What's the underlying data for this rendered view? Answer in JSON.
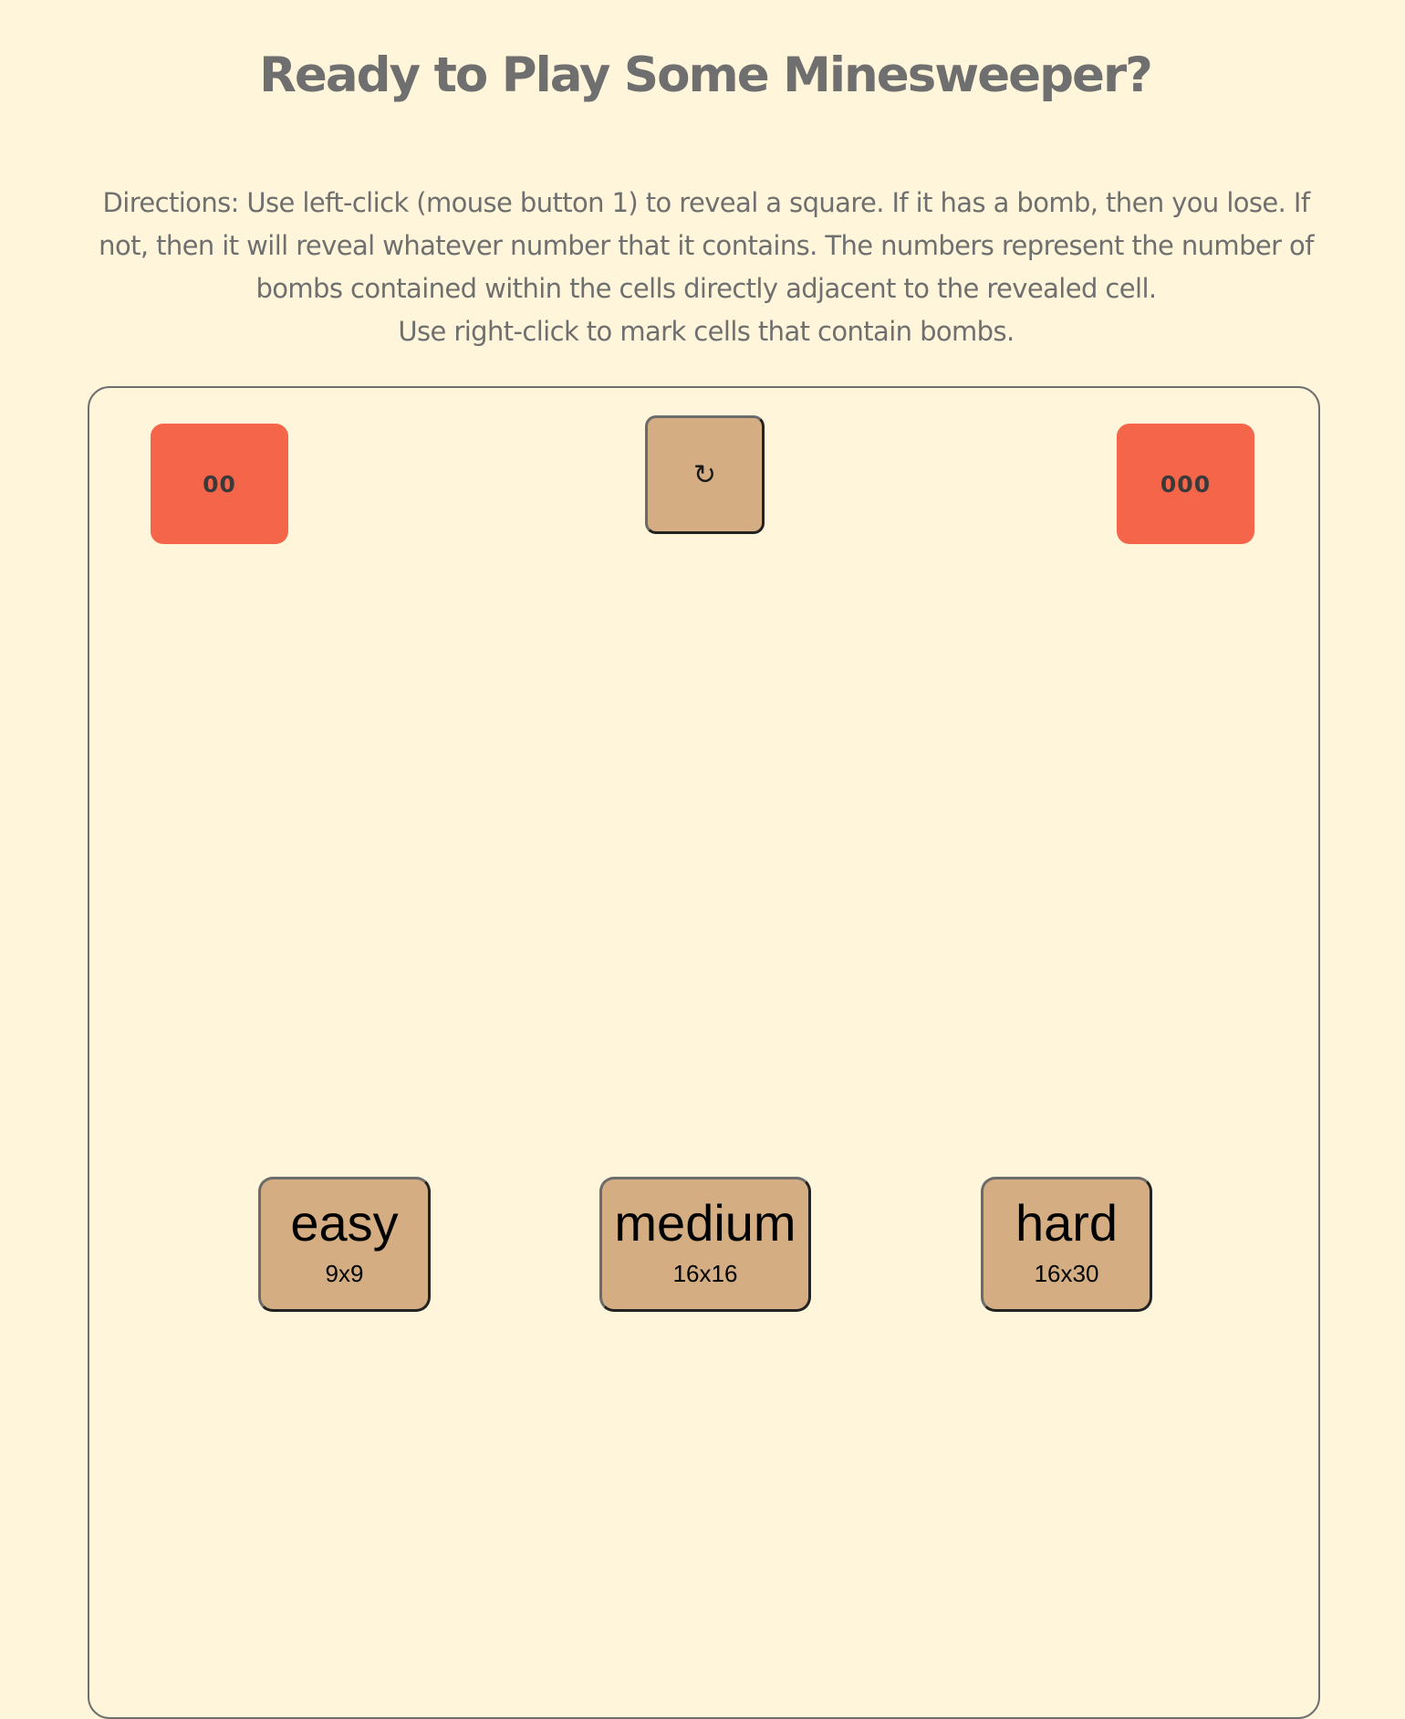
{
  "header": {
    "title": "Ready to Play Some Minesweeper?"
  },
  "directions": {
    "text": "Directions: Use left-click (mouse button 1) to reveal a square. If it has a bomb, then you lose. If not, then it will reveal whatever number that it contains. The numbers represent the number of bombs contained within the cells directly adjacent to the revealed cell.",
    "text2": "Use right-click to mark cells that contain bombs."
  },
  "board": {
    "mine_counter": "00",
    "reset_icon": "↻",
    "reset_icon_name": "refresh-icon",
    "timer": "000",
    "levels": [
      {
        "name": "easy",
        "size": "9x9"
      },
      {
        "name": "medium",
        "size": "16x16"
      },
      {
        "name": "hard",
        "size": "16x30"
      }
    ]
  },
  "colors": {
    "background": "#fef5da",
    "counter": "#f4654a",
    "button": "#d4ae82",
    "text": "#6f6f6f"
  }
}
